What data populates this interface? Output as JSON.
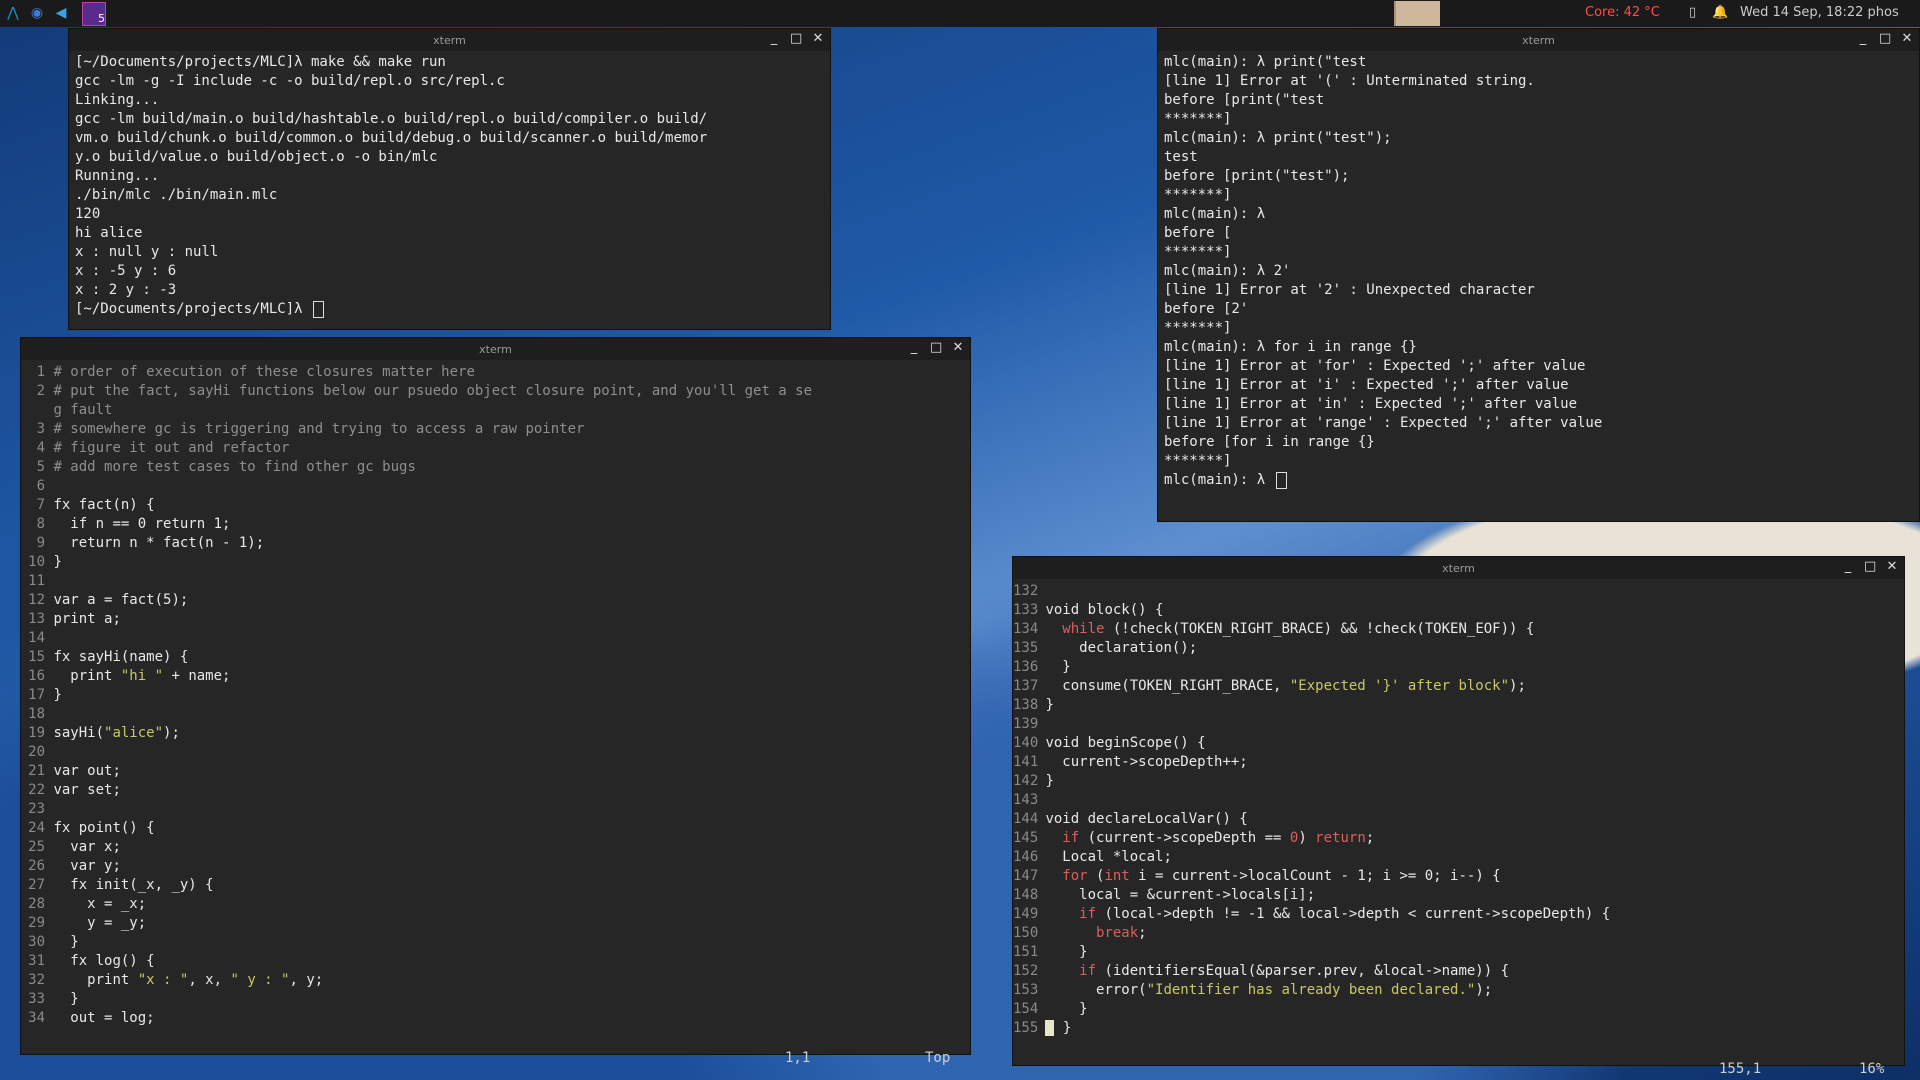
{
  "topbar": {
    "workspace_badge": "5",
    "temp": "Core: 42 °C",
    "clock": "Wed 14 Sep, 18:22  phos",
    "icons": [
      "arch-icon",
      "firefox-icon",
      "vscode-icon",
      "workspace-icon",
      "battery-icon",
      "bell-icon"
    ]
  },
  "colors": {
    "temp": "#ff4b4b",
    "string": "#c8c86a",
    "keyword": "#e05d5d",
    "comment": "#8e8e8e"
  },
  "win_make": {
    "title": "xterm",
    "lines": [
      "[~/Documents/projects/MLC]λ make && make run",
      "gcc -lm -g -I include -c -o build/repl.o src/repl.c",
      "Linking...",
      "gcc -lm build/main.o build/hashtable.o build/repl.o build/compiler.o build/",
      "vm.o build/chunk.o build/common.o build/debug.o build/scanner.o build/memor",
      "y.o build/value.o build/object.o -o bin/mlc",
      "Running...",
      "./bin/mlc ./bin/main.mlc",
      "120",
      "hi alice",
      "x : null y : null",
      "x : -5 y : 6",
      "x : 2 y : -3",
      "[~/Documents/projects/MLC]λ "
    ]
  },
  "win_repl": {
    "title": "xterm",
    "lines": [
      "mlc(main): λ print(\"test",
      "[line 1] Error at '(' : Unterminated string.",
      "before [print(\"test",
      "*******]",
      "mlc(main): λ print(\"test\");",
      "test",
      "before [print(\"test\");",
      "*******]",
      "mlc(main): λ",
      "before [",
      "*******]",
      "mlc(main): λ 2'",
      "[line 1] Error at '2' : Unexpected character",
      "before [2'",
      "*******]",
      "mlc(main): λ for i in range {}",
      "[line 1] Error at 'for' : Expected ';' after value",
      "[line 1] Error at 'i' : Expected ';' after value",
      "[line 1] Error at 'in' : Expected ';' after value",
      "[line 1] Error at 'range' : Expected ';' after value",
      "before [for i in range {}",
      "*******]",
      "mlc(main): λ "
    ]
  },
  "win_mlc": {
    "title": "xterm",
    "status_pos": "1,1",
    "status_pct": "Top",
    "rows": [
      {
        "n": "1",
        "segs": [
          [
            "c",
            "# order of execution of these closures matter here"
          ]
        ]
      },
      {
        "n": "2",
        "segs": [
          [
            "c",
            "# put the fact, sayHi functions below our psuedo object closure point, and you'll get a se"
          ]
        ]
      },
      {
        "n": "",
        "segs": [
          [
            "c",
            "g fault"
          ]
        ]
      },
      {
        "n": "3",
        "segs": [
          [
            "c",
            "# somewhere gc is triggering and trying to access a raw pointer"
          ]
        ]
      },
      {
        "n": "4",
        "segs": [
          [
            "c",
            "# figure it out and refactor"
          ]
        ]
      },
      {
        "n": "5",
        "segs": [
          [
            "c",
            "# add more test cases to find other gc bugs"
          ]
        ]
      },
      {
        "n": "6",
        "segs": []
      },
      {
        "n": "7",
        "segs": [
          [
            "t",
            "fx fact(n) {"
          ]
        ]
      },
      {
        "n": "8",
        "segs": [
          [
            "t",
            "  if n == 0 return 1;"
          ]
        ]
      },
      {
        "n": "9",
        "segs": [
          [
            "t",
            "  return n * fact(n - 1);"
          ]
        ]
      },
      {
        "n": "10",
        "segs": [
          [
            "t",
            "}"
          ]
        ]
      },
      {
        "n": "11",
        "segs": []
      },
      {
        "n": "12",
        "segs": [
          [
            "t",
            "var a = fact(5);"
          ]
        ]
      },
      {
        "n": "13",
        "segs": [
          [
            "t",
            "print a;"
          ]
        ]
      },
      {
        "n": "14",
        "segs": []
      },
      {
        "n": "15",
        "segs": [
          [
            "t",
            "fx sayHi(name) {"
          ]
        ]
      },
      {
        "n": "16",
        "segs": [
          [
            "t",
            "  print "
          ],
          [
            "s",
            "\"hi \""
          ],
          [
            "t",
            " + name;"
          ]
        ]
      },
      {
        "n": "17",
        "segs": [
          [
            "t",
            "}"
          ]
        ]
      },
      {
        "n": "18",
        "segs": []
      },
      {
        "n": "19",
        "segs": [
          [
            "t",
            "sayHi("
          ],
          [
            "s",
            "\"alice\""
          ],
          [
            "t",
            ");"
          ]
        ]
      },
      {
        "n": "20",
        "segs": []
      },
      {
        "n": "21",
        "segs": [
          [
            "t",
            "var out;"
          ]
        ]
      },
      {
        "n": "22",
        "segs": [
          [
            "t",
            "var set;"
          ]
        ]
      },
      {
        "n": "23",
        "segs": []
      },
      {
        "n": "24",
        "segs": [
          [
            "t",
            "fx point() {"
          ]
        ]
      },
      {
        "n": "25",
        "segs": [
          [
            "t",
            "  var x;"
          ]
        ]
      },
      {
        "n": "26",
        "segs": [
          [
            "t",
            "  var y;"
          ]
        ]
      },
      {
        "n": "27",
        "segs": [
          [
            "t",
            "  fx init(_x, _y) {"
          ]
        ]
      },
      {
        "n": "28",
        "segs": [
          [
            "t",
            "    x = _x;"
          ]
        ]
      },
      {
        "n": "29",
        "segs": [
          [
            "t",
            "    y = _y;"
          ]
        ]
      },
      {
        "n": "30",
        "segs": [
          [
            "t",
            "  }"
          ]
        ]
      },
      {
        "n": "31",
        "segs": [
          [
            "t",
            "  fx log() {"
          ]
        ]
      },
      {
        "n": "32",
        "segs": [
          [
            "t",
            "    print "
          ],
          [
            "s",
            "\"x : \""
          ],
          [
            "t",
            ", x, "
          ],
          [
            "s",
            "\" y : \""
          ],
          [
            "t",
            ", y;"
          ]
        ]
      },
      {
        "n": "33",
        "segs": [
          [
            "t",
            "  }"
          ]
        ]
      },
      {
        "n": "34",
        "segs": [
          [
            "t",
            "  out = log;"
          ]
        ]
      }
    ]
  },
  "win_c": {
    "title": "xterm",
    "status_pos": "155,1",
    "status_pct": "16%",
    "rows": [
      {
        "n": "132",
        "segs": []
      },
      {
        "n": "133",
        "segs": [
          [
            "t",
            "void block() {"
          ]
        ]
      },
      {
        "n": "134",
        "segs": [
          [
            "t",
            "  "
          ],
          [
            "k",
            "while"
          ],
          [
            "t",
            " (!check(TOKEN_RIGHT_BRACE) && !check(TOKEN_EOF)) {"
          ]
        ]
      },
      {
        "n": "135",
        "segs": [
          [
            "t",
            "    declaration();"
          ]
        ]
      },
      {
        "n": "136",
        "segs": [
          [
            "t",
            "  }"
          ]
        ]
      },
      {
        "n": "137",
        "segs": [
          [
            "t",
            "  consume(TOKEN_RIGHT_BRACE, "
          ],
          [
            "s",
            "\"Expected '}' after block\""
          ],
          [
            "t",
            ");"
          ]
        ]
      },
      {
        "n": "138",
        "segs": [
          [
            "t",
            "}"
          ]
        ]
      },
      {
        "n": "139",
        "segs": []
      },
      {
        "n": "140",
        "segs": [
          [
            "t",
            "void beginScope() {"
          ]
        ]
      },
      {
        "n": "141",
        "segs": [
          [
            "t",
            "  current->scopeDepth++;"
          ]
        ]
      },
      {
        "n": "142",
        "segs": [
          [
            "t",
            "}"
          ]
        ]
      },
      {
        "n": "143",
        "segs": []
      },
      {
        "n": "144",
        "segs": [
          [
            "t",
            "void declareLocalVar() {"
          ]
        ]
      },
      {
        "n": "145",
        "segs": [
          [
            "t",
            "  "
          ],
          [
            "k",
            "if"
          ],
          [
            "t",
            " (current->scopeDepth == "
          ],
          [
            "k",
            "0"
          ],
          [
            "t",
            ") "
          ],
          [
            "k",
            "return"
          ],
          [
            "t",
            ";"
          ]
        ]
      },
      {
        "n": "146",
        "segs": [
          [
            "t",
            "  Local *local;"
          ]
        ]
      },
      {
        "n": "147",
        "segs": [
          [
            "t",
            "  "
          ],
          [
            "k",
            "for"
          ],
          [
            "t",
            " ("
          ],
          [
            "k",
            "int"
          ],
          [
            "t",
            " i = current->localCount - 1; i >= 0; i--) {"
          ]
        ]
      },
      {
        "n": "148",
        "segs": [
          [
            "t",
            "    local = &current->locals[i];"
          ]
        ]
      },
      {
        "n": "149",
        "segs": [
          [
            "t",
            "    "
          ],
          [
            "k",
            "if"
          ],
          [
            "t",
            " (local->depth != -1 && local->depth < current->scopeDepth) {"
          ]
        ]
      },
      {
        "n": "150",
        "segs": [
          [
            "t",
            "      "
          ],
          [
            "k",
            "break"
          ],
          [
            "t",
            ";"
          ]
        ]
      },
      {
        "n": "151",
        "segs": [
          [
            "t",
            "    }"
          ]
        ]
      },
      {
        "n": "152",
        "segs": [
          [
            "t",
            "    "
          ],
          [
            "k",
            "if"
          ],
          [
            "t",
            " (identifiersEqual(&parser.prev, &local->name)) {"
          ]
        ]
      },
      {
        "n": "153",
        "segs": [
          [
            "t",
            "      error("
          ],
          [
            "s",
            "\"Identifier has already been declared.\""
          ],
          [
            "t",
            ");"
          ]
        ]
      },
      {
        "n": "154",
        "segs": [
          [
            "t",
            "    }"
          ]
        ]
      },
      {
        "n": "155",
        "segs": [
          [
            "cur",
            ""
          ],
          [
            "t",
            " }"
          ]
        ]
      }
    ]
  }
}
